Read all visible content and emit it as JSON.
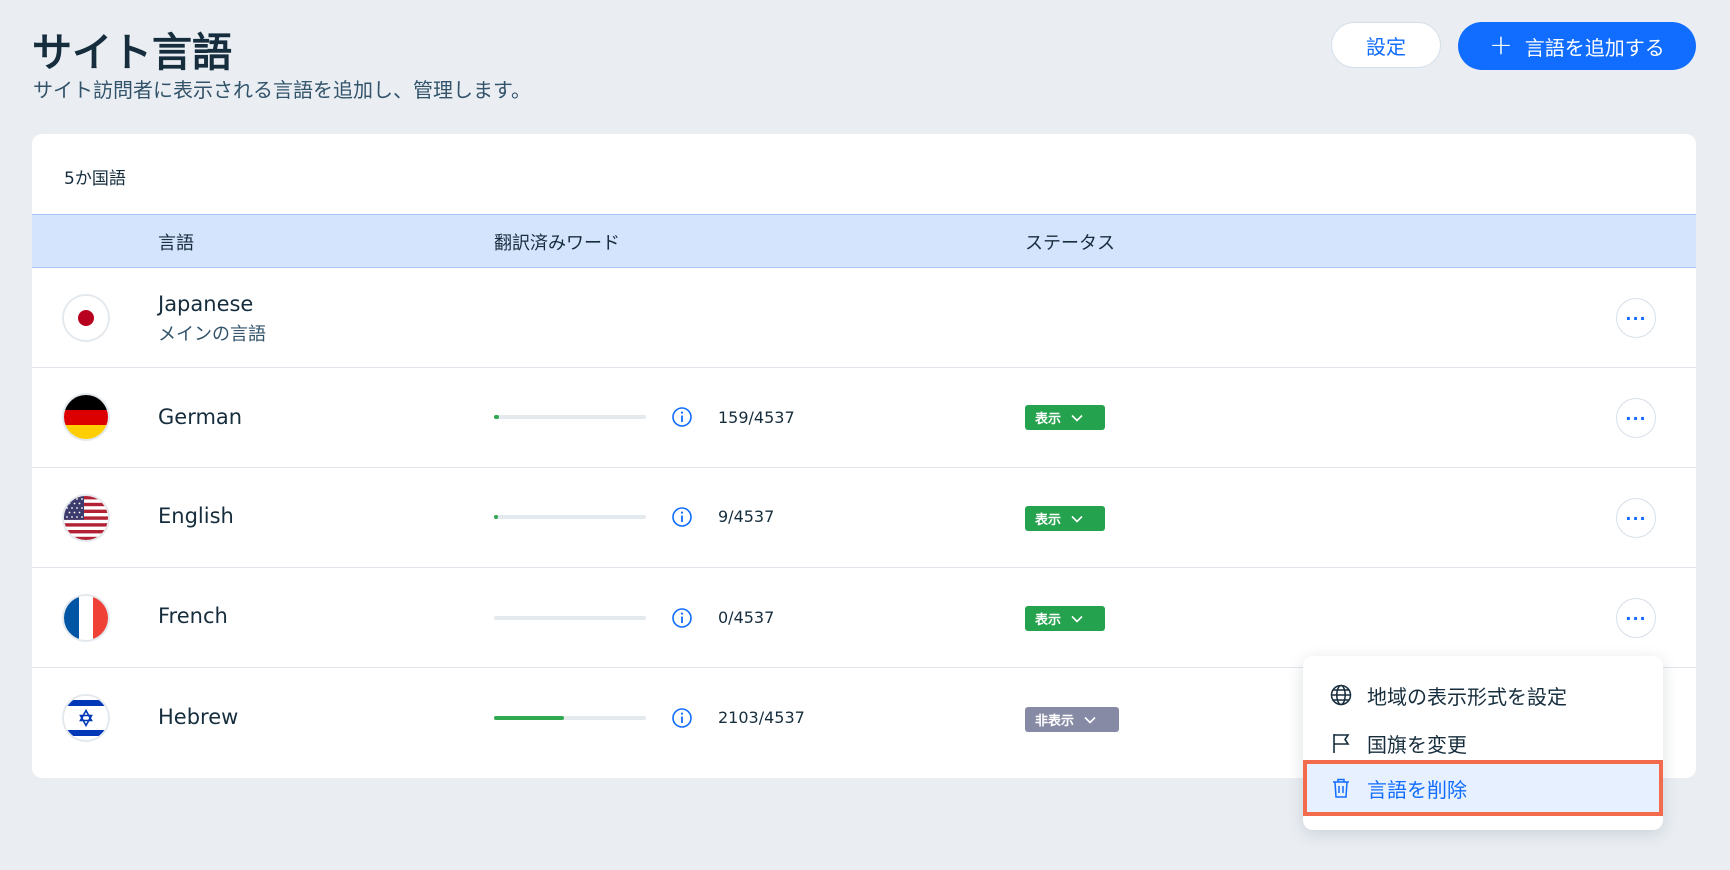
{
  "header": {
    "title": "サイト言語",
    "subtitle": "サイト訪問者に表示される言語を追加し、管理します。",
    "settings_label": "設定",
    "add_label": "言語を追加する"
  },
  "card": {
    "count_label": "5か国語",
    "columns": {
      "language": "言語",
      "translated_words": "翻訳済みワード",
      "status": "ステータス"
    }
  },
  "languages": [
    {
      "name": "Japanese",
      "subtitle": "メインの言語",
      "flag": "jp-flag-icon"
    },
    {
      "name": "German",
      "words": "159/4537",
      "progress": 0.035,
      "status": "表示",
      "flag": "de-flag-icon"
    },
    {
      "name": "English",
      "words": "9/4537",
      "progress": 0.002,
      "status": "表示",
      "flag": "us-flag-icon"
    },
    {
      "name": "French",
      "words": "0/4537",
      "progress": 0.0,
      "status": "表示",
      "flag": "fr-flag-icon"
    },
    {
      "name": "Hebrew",
      "words": "2103/4537",
      "progress": 0.4635,
      "status": "非表示",
      "flag": "il-flag-icon"
    }
  ],
  "menu": {
    "items": [
      {
        "label": "地域の表示形式を設定",
        "icon": "globe-icon"
      },
      {
        "label": "国旗を変更",
        "icon": "flag-icon"
      },
      {
        "label": "言語を削除",
        "icon": "trash-icon"
      }
    ]
  },
  "colors": {
    "accent": "#116dff",
    "shown": "#25a24d",
    "hidden": "#868aa5",
    "highlight_border": "#f26b4c"
  }
}
